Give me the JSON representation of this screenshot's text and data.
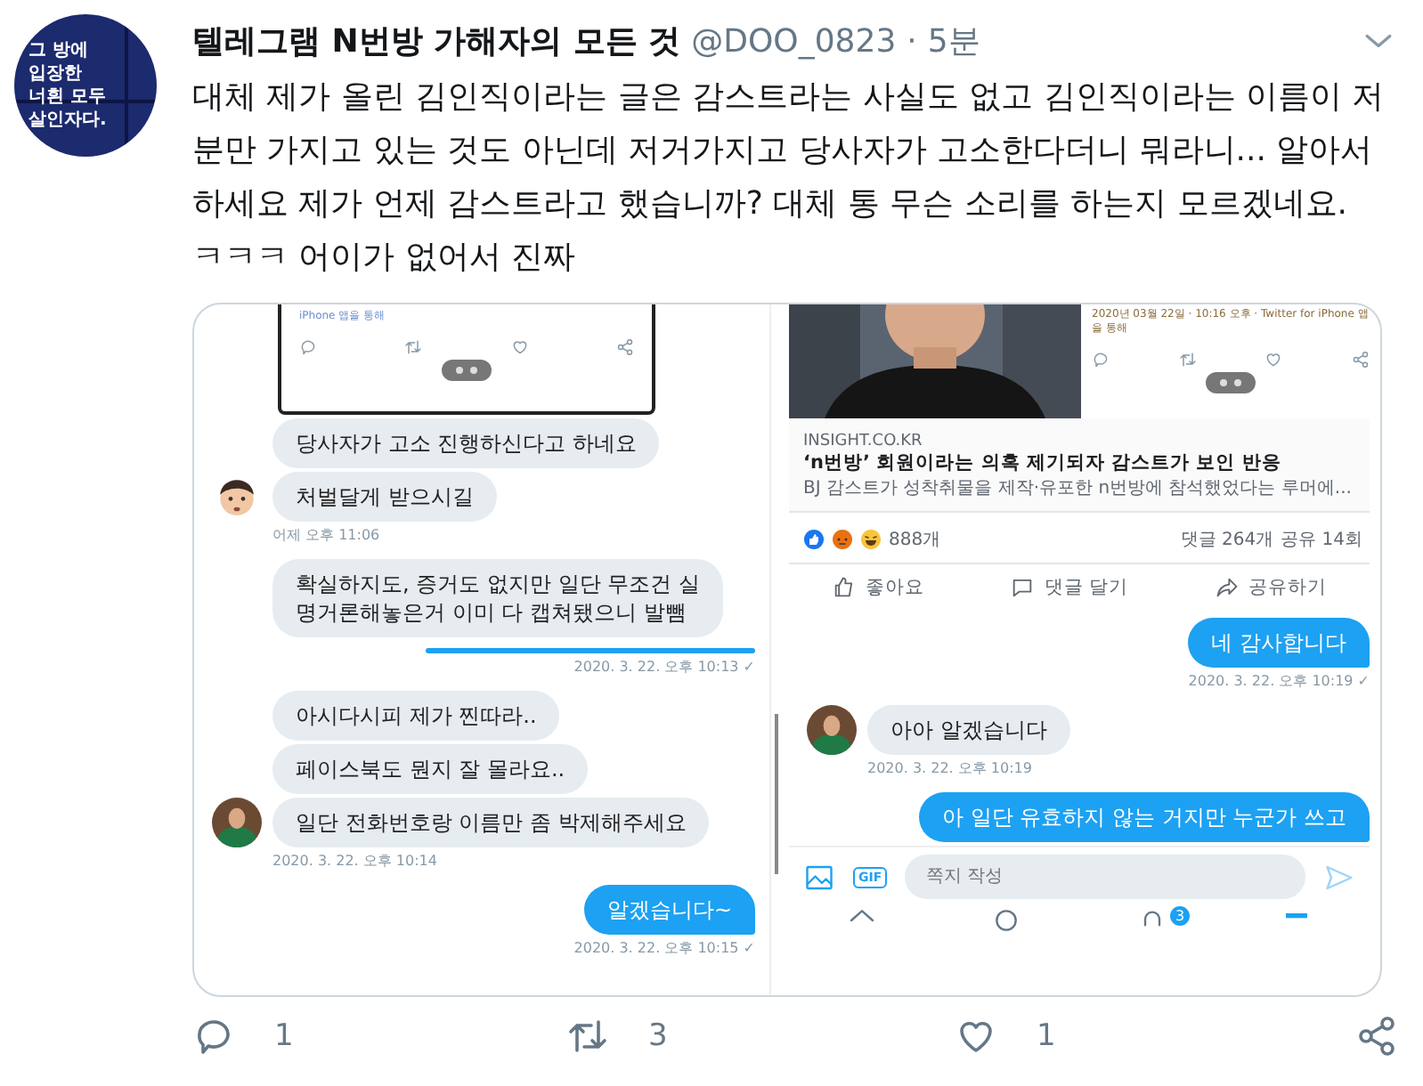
{
  "tweet": {
    "avatar_text": "그 방에\n입장한\n너흰 모두\n살인자다.",
    "author_name": "텔레그램 N번방 가해자의 모든 것",
    "handle": "@DOO_0823",
    "separator": "·",
    "time": "5분",
    "text": "대체 제가 올린 김인직이라는 글은 감스트라는 사실도 없고 김인직이라는 이름이 저 분만 가지고 있는 것도 아닌데 저거가지고 당사자가 고소한다더니 뭐라니... 알아서 하세요 제가 언제 감스트라고 했습니까? 대체 통 무슨 소리를 하는지 모르겠네요. ㅋㅋㅋ 어이가 없어서 진짜"
  },
  "left_shot": {
    "embedded_meta": "iPhone 앱을 통해",
    "messages": [
      {
        "kind": "in",
        "text": "당사자가 고소 진행하신다고 하네요"
      },
      {
        "kind": "in",
        "text": "처벌달게 받으시길",
        "avatar": {
          "kind": "cartoon"
        }
      },
      {
        "kind": "time",
        "text": "어제 오후 11:06"
      },
      {
        "kind": "in",
        "text": "확실하지도, 증거도 없지만 일단 무조건 실\n명거론해놓은거 이미 다 캡쳐됐으니 발뺌"
      },
      {
        "kind": "edge"
      },
      {
        "kind": "time_out",
        "text": "2020. 3. 22. 오후 10:13 ✓"
      },
      {
        "kind": "in",
        "text": "아시다시피 제가 찐따라.."
      },
      {
        "kind": "in",
        "text": "페이스북도 뭔지 잘 몰라요.."
      },
      {
        "kind": "in",
        "text": "일단 전화번호랑 이름만 좀 박제해주세요"
      },
      {
        "kind": "time",
        "text": "2020. 3. 22. 오후 10:14"
      },
      {
        "kind": "out",
        "text": "알겠습니다~"
      },
      {
        "kind": "time_out",
        "text": "2020. 3. 22. 오후 10:15 ✓"
      }
    ]
  },
  "right_shot": {
    "embedded_meta": "2020년 03월 22일 · 10:16 오후 · Twitter for iPhone 앱을 통해",
    "link": {
      "domain": "INSIGHT.CO.KR",
      "title": "‘n번방’ 회원이라는 의혹 제기되자 감스트가 보인 반응",
      "description": "BJ 감스트가 성착취물을 제작·유포한 n번방에 참석했었다는 루머에..."
    },
    "reactions": {
      "count": "888개",
      "comments": "댓글 264개",
      "shares": "공유 14회"
    },
    "fb_actions": [
      {
        "kind": "like",
        "label": "좋아요"
      },
      {
        "kind": "comment",
        "label": "댓글 달기"
      },
      {
        "kind": "share",
        "label": "공유하기"
      }
    ],
    "messages": [
      {
        "kind": "out",
        "text": "네 감사합니다"
      },
      {
        "kind": "time_out",
        "text": "2020. 3. 22. 오후 10:19 ✓"
      },
      {
        "kind": "in",
        "text": "아아 알겠습니다"
      },
      {
        "kind": "time",
        "text": "2020. 3. 22. 오후 10:19"
      },
      {
        "kind": "out",
        "text": "아 일단 유효하지 않는 거지만 누군가 쓰고"
      }
    ],
    "composer": {
      "gif": "GIF",
      "placeholder": "쪽지 작성"
    },
    "nav_badge": "3"
  },
  "actions": [
    {
      "kind": "reply",
      "count": "1"
    },
    {
      "kind": "retweet",
      "count": "3"
    },
    {
      "kind": "like",
      "count": "1"
    },
    {
      "kind": "share"
    }
  ]
}
